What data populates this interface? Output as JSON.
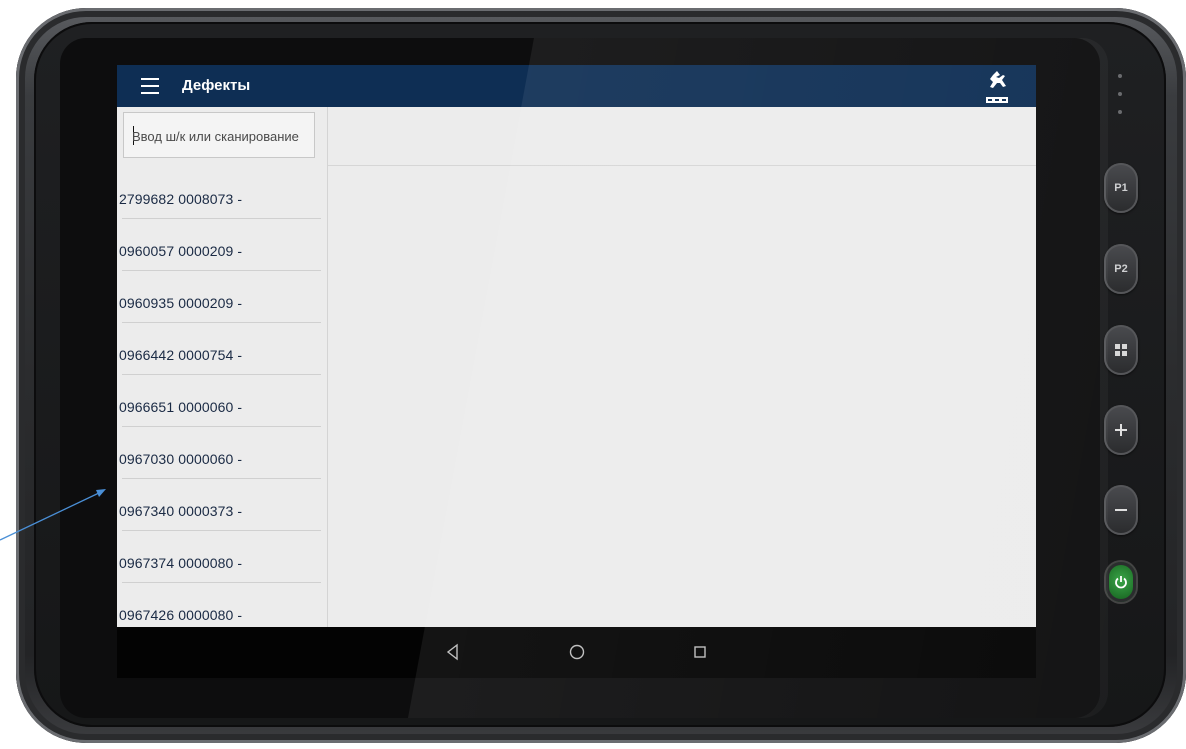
{
  "app": {
    "title": "Дефекты",
    "brand_logo": "gaz-deer-logo",
    "header_color": "#0e2e54"
  },
  "search": {
    "placeholder": "Ввод ш/к или сканирование",
    "value": ""
  },
  "items": [
    {
      "label": "2799682 0008073 -"
    },
    {
      "label": "0960057 0000209 -"
    },
    {
      "label": "0960935 0000209 -"
    },
    {
      "label": "0966442 0000754 -"
    },
    {
      "label": "0966651 0000060 -"
    },
    {
      "label": "0967030 0000060 -"
    },
    {
      "label": "0967340 0000373 -"
    },
    {
      "label": "0967374 0000080 -"
    },
    {
      "label": "0967426 0000080 -"
    }
  ],
  "navigation": {
    "back": "back-triangle-icon",
    "home": "home-circle-icon",
    "recents": "recents-square-icon"
  },
  "hardware_buttons": {
    "p1": "P1",
    "p2": "P2"
  }
}
